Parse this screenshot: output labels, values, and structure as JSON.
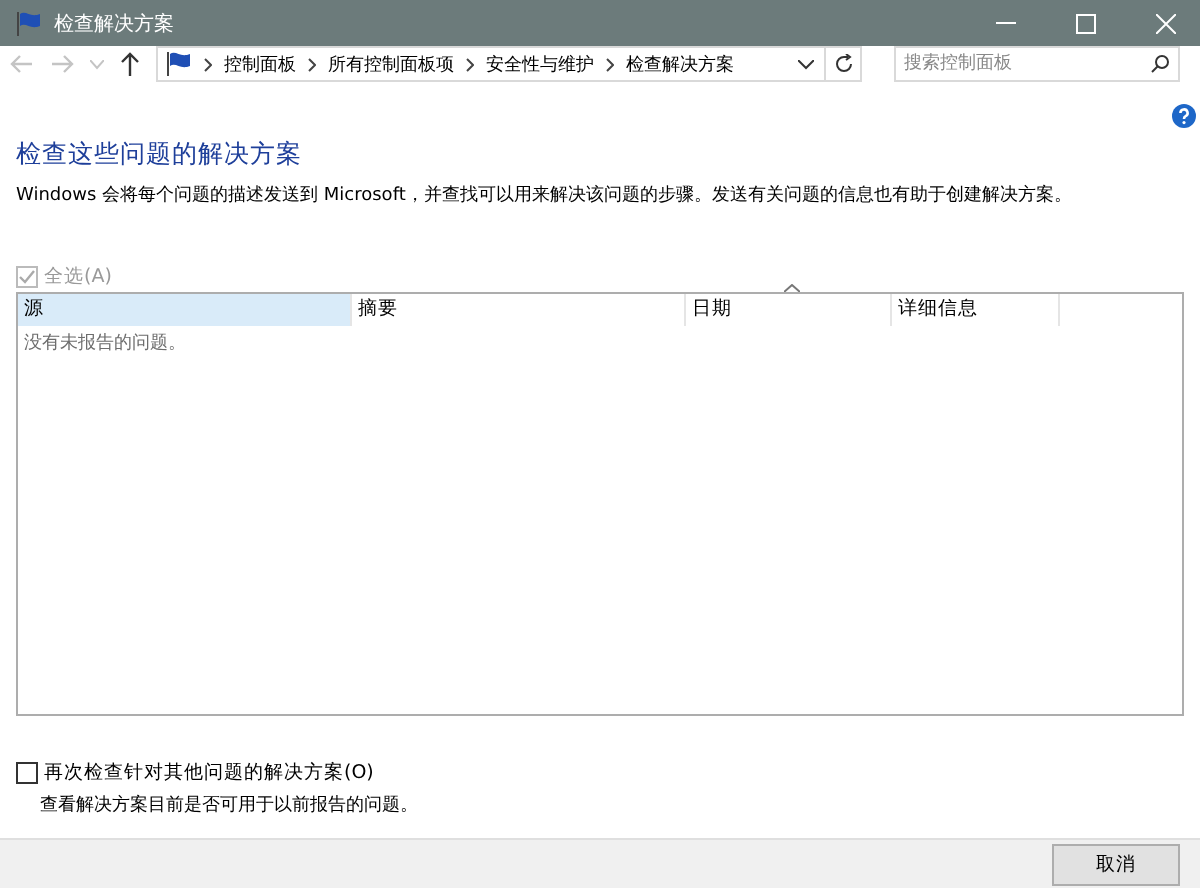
{
  "window": {
    "title": "检查解决方案"
  },
  "address_bar": {
    "crumbs": [
      "控制面板",
      "所有控制面板项",
      "安全性与维护",
      "检查解决方案"
    ]
  },
  "search": {
    "placeholder": "搜索控制面板"
  },
  "heading": "检查这些问题的解决方案",
  "description": "Windows 会将每个问题的描述发送到 Microsoft，并查找可以用来解决该问题的步骤。发送有关问题的信息也有助于创建解决方案。",
  "select_all": {
    "label": "全选(A)",
    "checked": true,
    "disabled": true
  },
  "table": {
    "columns": [
      {
        "label": "源",
        "selected": true
      },
      {
        "label": "摘要",
        "selected": false
      },
      {
        "label": "日期",
        "selected": false
      },
      {
        "label": "详细信息",
        "selected": false
      }
    ],
    "empty_message": "没有未报告的问题。"
  },
  "recheck": {
    "label": "再次检查针对其他问题的解决方案(O)",
    "checked": false,
    "disabled": false,
    "hint": "查看解决方案目前是否可用于以前报告的问题。"
  },
  "buttons": [
    "取消"
  ]
}
